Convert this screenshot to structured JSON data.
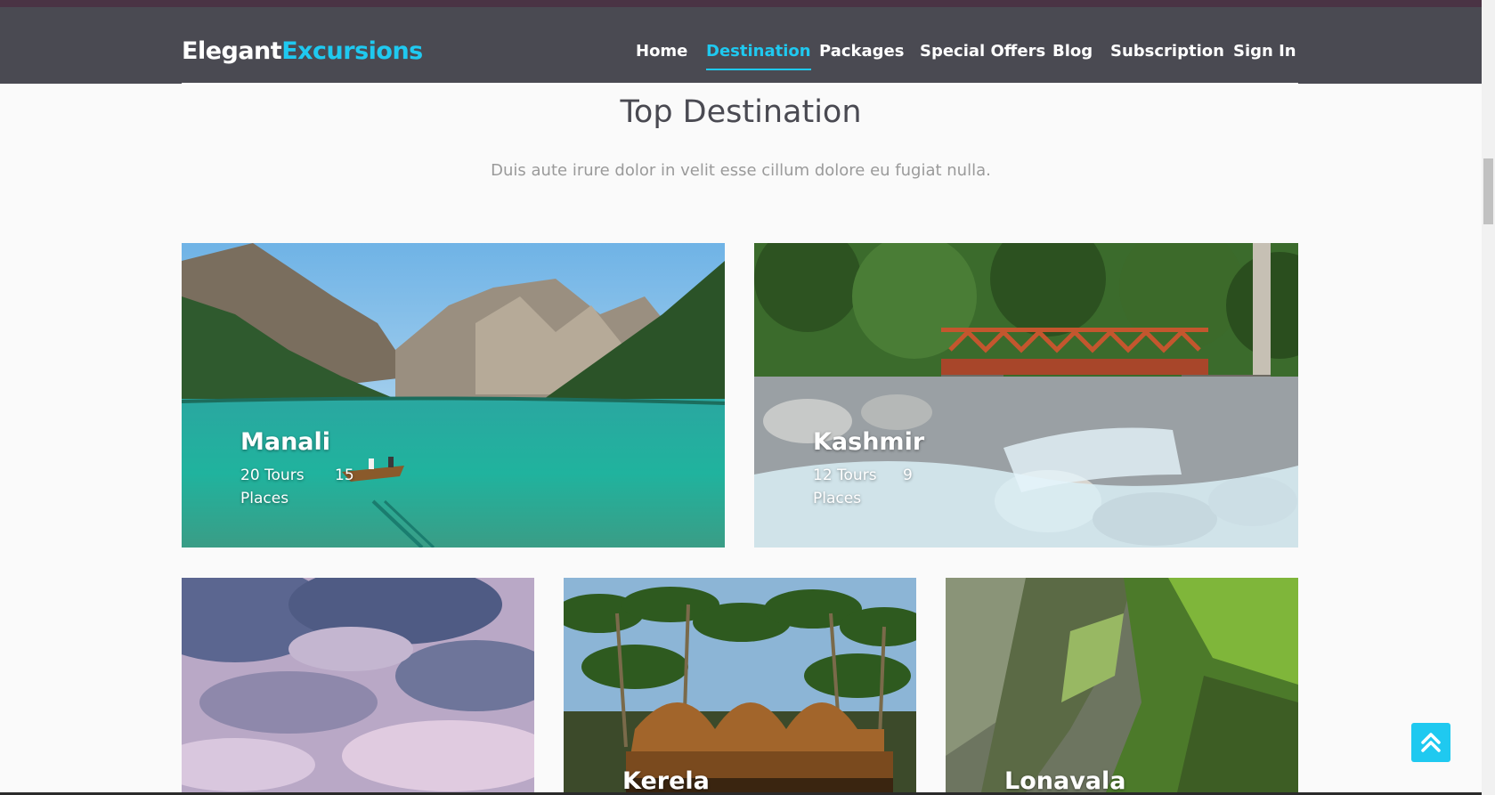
{
  "brand": {
    "part1": "Elegant",
    "part2": "Excursions"
  },
  "nav": {
    "items": [
      {
        "label": "Home"
      },
      {
        "label": "Destination",
        "active": true
      },
      {
        "label": "Packages"
      },
      {
        "label": "Special Offers"
      },
      {
        "label": "Blog"
      },
      {
        "label": "Subscription"
      },
      {
        "label": "Sign In"
      }
    ]
  },
  "section": {
    "title": "Top Destination",
    "subtitle": "Duis aute irure dolor in velit esse cillum dolore eu fugiat nulla."
  },
  "destinations": [
    {
      "name": "Manali",
      "tours": "20 Tours",
      "places_count": "15",
      "places_label": "Places",
      "image": "lake-mountains-boat"
    },
    {
      "name": "Kashmir",
      "tours": "12 Tours",
      "places_count": "9",
      "places_label": "Places",
      "image": "river-bridge-forest"
    },
    {
      "name": "",
      "image": "cloudy-sky"
    },
    {
      "name": "Kerela",
      "image": "houseboat-palms"
    },
    {
      "name": "Lonavala",
      "image": "green-cliffs"
    }
  ],
  "colors": {
    "accent": "#1fc9f0",
    "navbar": "#4a4a52",
    "top_strip": "#4a3344"
  },
  "icons": {
    "back_to_top": "double-chevron-up-icon"
  }
}
